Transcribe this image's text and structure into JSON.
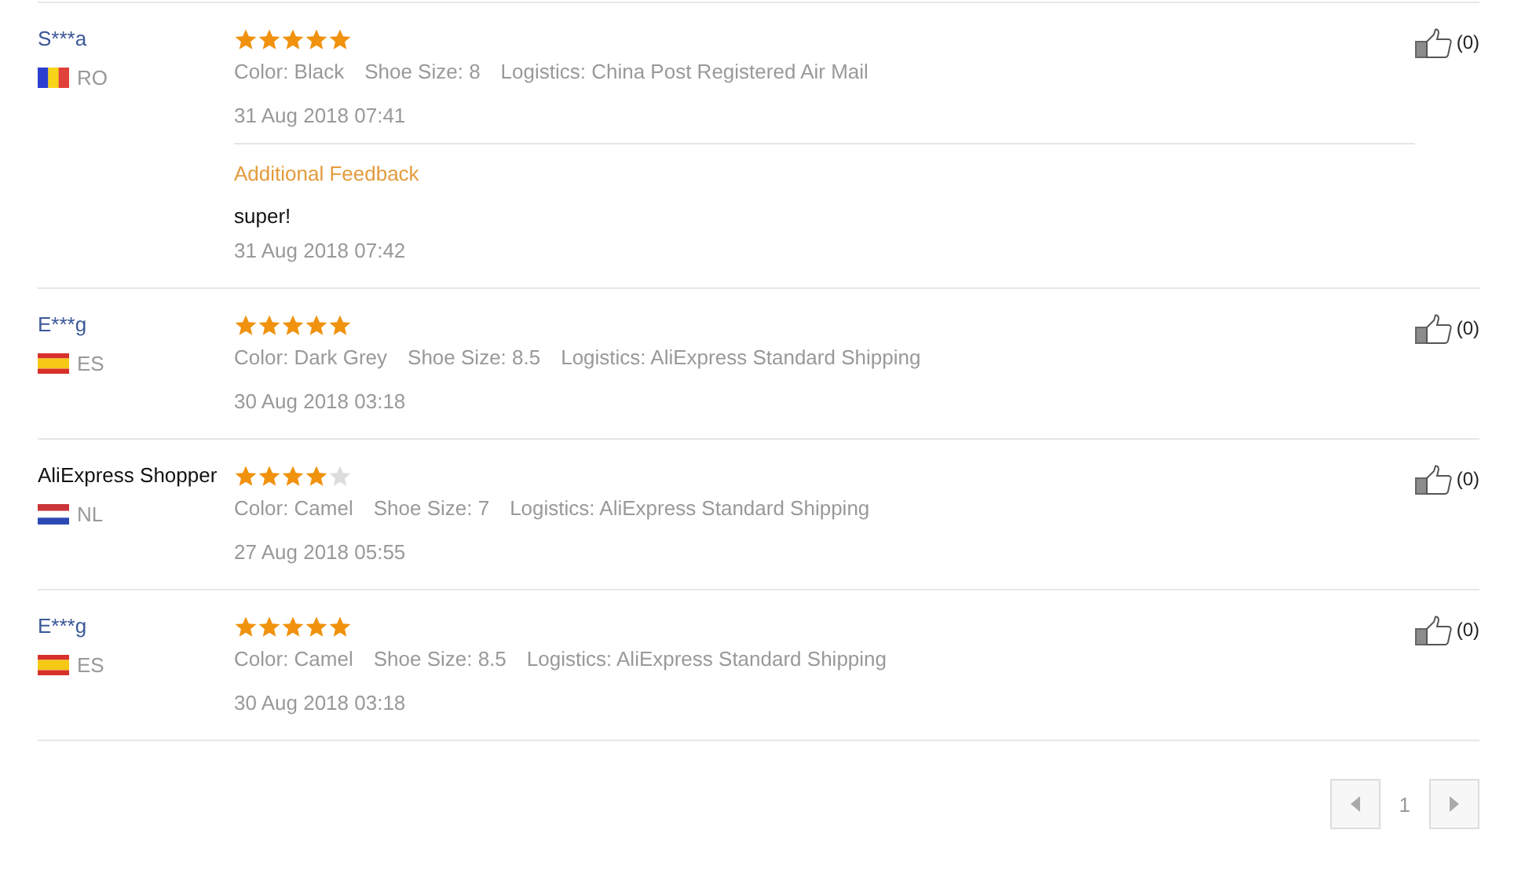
{
  "reviews": [
    {
      "name": "S***a",
      "kind": "masked",
      "flag": {
        "kind": "ro"
      },
      "country": "RO",
      "stars": 5,
      "attributes": [
        "Color: Black",
        "Shoe Size: 8",
        "Logistics: China Post Registered Air Mail"
      ],
      "date": "31 Aug 2018 07:41",
      "helpful": "(0)",
      "additional": {
        "title": "Additional Feedback",
        "text": "super!",
        "date": "31 Aug 2018 07:42"
      }
    },
    {
      "name": "E***g",
      "kind": "masked",
      "flag": {
        "kind": "es"
      },
      "country": "ES",
      "stars": 5,
      "attributes": [
        "Color: Dark Grey",
        "Shoe Size: 8.5",
        "Logistics: AliExpress Standard Shipping"
      ],
      "date": "30 Aug 2018 03:18",
      "helpful": "(0)"
    },
    {
      "name": "AliExpress Shopper",
      "kind": "plain",
      "flag": {
        "kind": "nl"
      },
      "country": "NL",
      "stars": 4,
      "attributes": [
        "Color: Camel",
        "Shoe Size: 7",
        "Logistics: AliExpress Standard Shipping"
      ],
      "date": "27 Aug 2018 05:55",
      "helpful": "(0)"
    },
    {
      "name": "E***g",
      "kind": "masked",
      "flag": {
        "kind": "es"
      },
      "country": "ES",
      "stars": 5,
      "attributes": [
        "Color: Camel",
        "Shoe Size: 8.5",
        "Logistics: AliExpress Standard Shipping"
      ],
      "date": "30 Aug 2018 03:18",
      "helpful": "(0)"
    }
  ],
  "pagination": {
    "current": "1"
  }
}
